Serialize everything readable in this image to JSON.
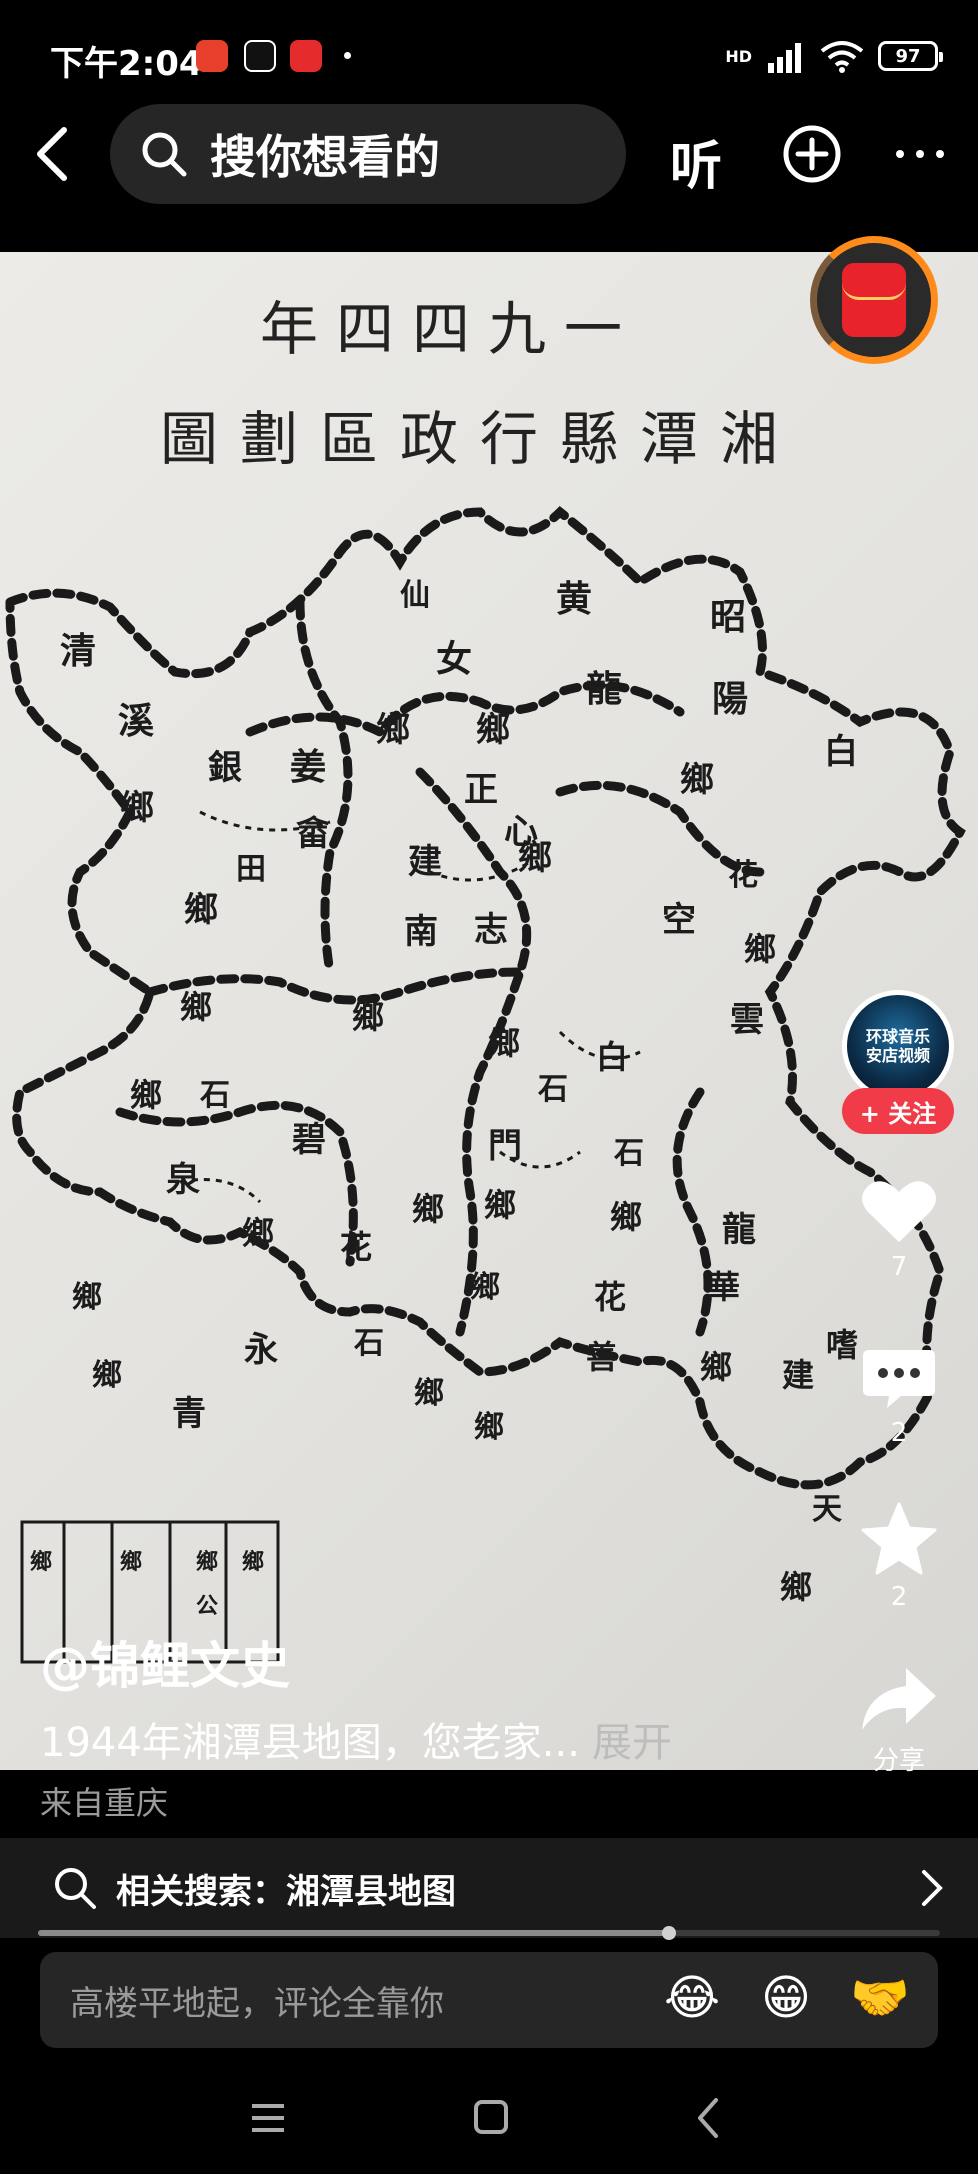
{
  "status_bar": {
    "time": "下午2:04",
    "network": "HD",
    "battery": "97"
  },
  "top_nav": {
    "search_placeholder": "搜你想看的",
    "listen_label": "听"
  },
  "map_image": {
    "title_year": "年四四九一",
    "title_main": "圖劃區政行縣潭湘",
    "labels": [
      "仙",
      "女",
      "黄",
      "龍",
      "昭",
      "陽",
      "清",
      "溪",
      "白",
      "鄉",
      "鄉",
      "鄉",
      "姜",
      "畲",
      "正",
      "心",
      "鄉",
      "鄉",
      "銀",
      "田",
      "鄉",
      "建",
      "南",
      "志",
      "空",
      "花",
      "雲",
      "鄉",
      "鄉",
      "石",
      "鄉",
      "泉",
      "碧",
      "鄉",
      "石",
      "鄉",
      "鄉",
      "門",
      "鄉",
      "龍",
      "華",
      "鄉",
      "嗜",
      "建",
      "鄉",
      "花",
      "石",
      "鄉",
      "白",
      "石",
      "鄉",
      "花",
      "善",
      "鄉",
      "永",
      "青",
      "鄉",
      "鄉",
      "鄉",
      "天",
      "鄉",
      "鄉",
      "鄉",
      "公",
      "鄉",
      "鄉"
    ]
  },
  "right_rail": {
    "avatar_text": "环球音乐\n安店视频",
    "follow_label": "+ 关注",
    "like_count": "7",
    "comment_count": "2",
    "favorite_count": "2",
    "share_label": "分享"
  },
  "caption": {
    "author": "@锦鲤文史",
    "text": "1944年湘潭县地图，您老家...",
    "expand_label": "展开",
    "location": "来自重庆"
  },
  "related_search": {
    "text": "相关搜索：湘潭县地图"
  },
  "playback": {
    "progress": 0.7
  },
  "comment_bar": {
    "placeholder": "高楼平地起，评论全靠你",
    "emojis": [
      "😂",
      "😁",
      "🤝"
    ]
  }
}
